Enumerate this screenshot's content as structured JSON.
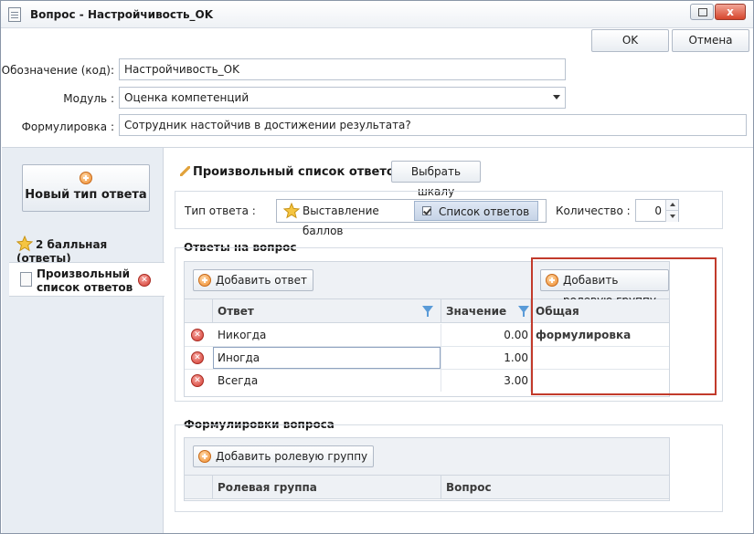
{
  "window": {
    "title": "Вопрос - Настройчивость_OK",
    "close_glyph": "x"
  },
  "toolbar": {
    "ok_label": "OK",
    "cancel_label": "Отмена"
  },
  "form": {
    "code_label": "Обозначение (код):",
    "code_value": "Настройчивость_OK",
    "module_label": "Модуль :",
    "module_value": "Оценка компетенций",
    "wording_label": "Формулировка :",
    "wording_value": "Сотрудник настойчив в достижении результата?"
  },
  "left_panel": {
    "new_type_label": "Новый тип ответа",
    "items": [
      {
        "label": "2 балльная (ответы)"
      },
      {
        "label": "Произвольный список ответов"
      }
    ]
  },
  "answer_type": {
    "section_title": "Произвольный список ответов",
    "choose_scale_label": "Выбрать шкалу",
    "type_label": "Тип ответа :",
    "option_points": "Выставление баллов",
    "option_list": "Список ответов",
    "selected": "Список ответов",
    "count_label": "Количество :",
    "count_value": "0"
  },
  "answers": {
    "title": "Ответы на вопрос",
    "add_answer_label": "Добавить ответ",
    "add_role_group_label": "Добавить ролевую группу",
    "columns": [
      "Ответ",
      "Значение",
      "Общая формулировка"
    ],
    "rows": [
      {
        "answer": "Никогда",
        "value": "0.00",
        "common": ""
      },
      {
        "answer": "Иногда",
        "value": "1.00",
        "common": ""
      },
      {
        "answer": "Всегда",
        "value": "3.00",
        "common": ""
      }
    ]
  },
  "wordings": {
    "title": "Формулировки вопроса",
    "add_role_group_label": "Добавить ролевую группу",
    "columns": [
      "Ролевая группа",
      "Вопрос"
    ]
  },
  "colors": {
    "highlight": "#c23a2b",
    "add_icon": "#ef8a2b",
    "delete_icon": "#d33a2f",
    "selected_segment": "#c6d4e7"
  }
}
